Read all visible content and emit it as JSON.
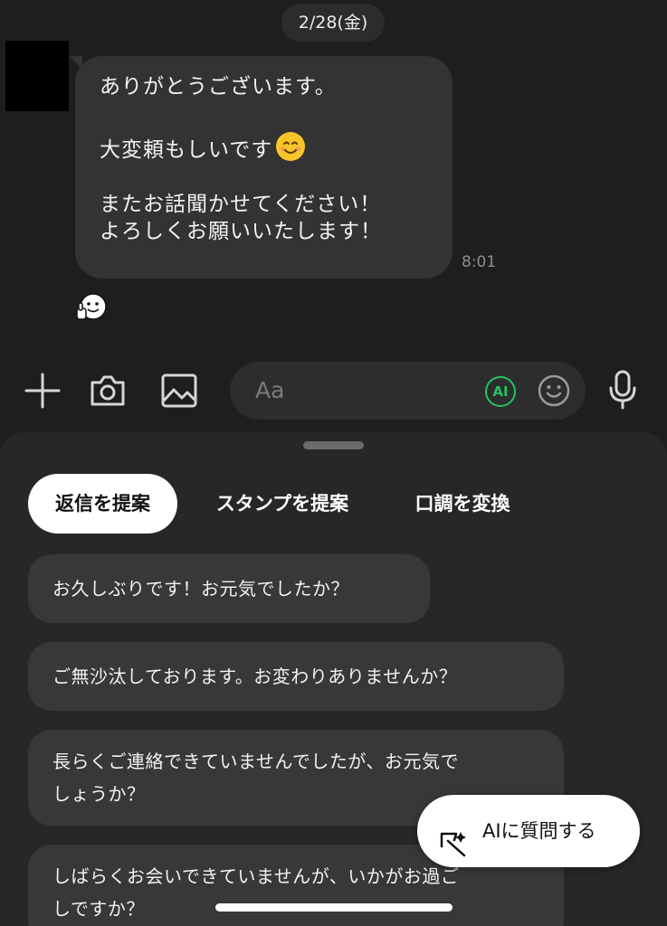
{
  "chat": {
    "date": "2/28(金)",
    "message": {
      "line1": "ありがとうございます。",
      "line2": "大変頼もしいです",
      "line3": "またお話聞かせてください！",
      "line4": "よろしくお願いいたします！",
      "emoji": "smiling-face-emoji"
    },
    "timestamp": "8:01",
    "reaction": "sticker-thumbs-up-reaction"
  },
  "input_bar": {
    "placeholder": "Aa",
    "ai_badge": "AI",
    "icons": [
      "plus-icon",
      "camera-icon",
      "image-icon",
      "emoji-icon",
      "microphone-icon"
    ]
  },
  "panel": {
    "tabs": [
      {
        "label": "返信を提案",
        "active": true
      },
      {
        "label": "スタンプを提案",
        "active": false
      },
      {
        "label": "口調を変換",
        "active": false
      }
    ],
    "suggestions": [
      {
        "lines": [
          "お久しぶりです！お元気でしたか？"
        ]
      },
      {
        "lines": [
          "ご無沙汰しております。お変わりありませんか？"
        ]
      },
      {
        "lines": [
          "長らくご連絡できていませんでしたが、お元気で",
          "しょうか？"
        ]
      },
      {
        "lines": [
          "しばらくお会いできていませんが、いかがお過ご",
          "しですか？"
        ]
      }
    ],
    "ask_ai_label": "AIに質問する"
  },
  "colors": {
    "background": "#1e1e1e",
    "bubble": "#333333",
    "panel": "#272727",
    "suggestion": "#383838",
    "ai_green": "#22c55e"
  }
}
